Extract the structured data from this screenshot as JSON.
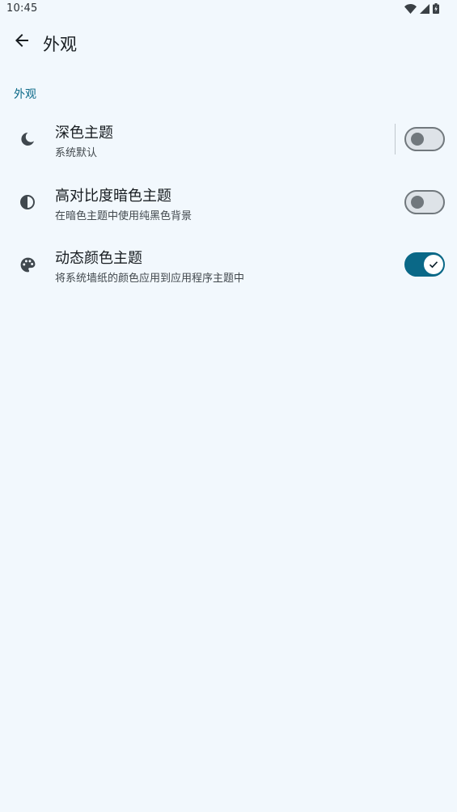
{
  "status_bar": {
    "time": "10:45",
    "icons": [
      "wifi-icon",
      "signal-icon",
      "battery-charging-icon"
    ]
  },
  "top_bar": {
    "back_icon": "arrow-back-icon",
    "title": "外观"
  },
  "section": {
    "header": "外观"
  },
  "preferences": [
    {
      "icon": "moon-icon",
      "title": "深色主题",
      "summary": "系统默认",
      "switch_on": false
    },
    {
      "icon": "contrast-icon",
      "title": "高对比度暗色主题",
      "summary": "在暗色主题中使用纯黑色背景",
      "switch_on": false
    },
    {
      "icon": "palette-icon",
      "title": "动态颜色主题",
      "summary": "将系统墙纸的颜色应用到应用程序主题中",
      "switch_on": true
    }
  ],
  "colors": {
    "background": "#f2f8fd",
    "accent": "#0a6887",
    "icon": "#40484e",
    "switch_off_track": "#dee3e8",
    "switch_off_outline": "#71787d"
  }
}
